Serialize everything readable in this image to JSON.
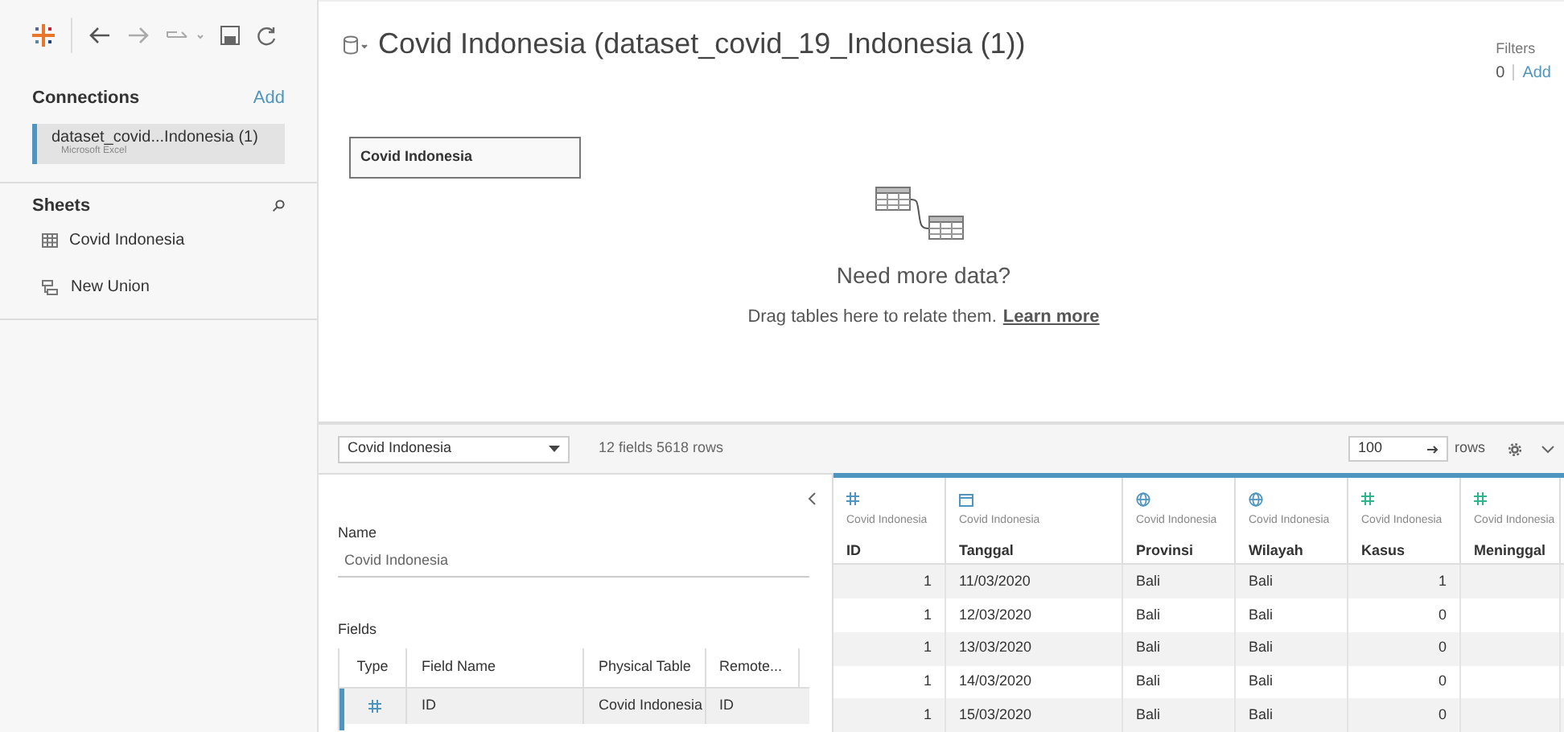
{
  "connections": {
    "title": "Connections",
    "add": "Add",
    "items": [
      {
        "name": "dataset_covid...Indonesia (1)",
        "type": "Microsoft Excel",
        "selected": true
      }
    ]
  },
  "sheets": {
    "title": "Sheets",
    "items": [
      {
        "kind": "table",
        "label": "Covid Indonesia"
      },
      {
        "kind": "union",
        "label": "New Union"
      }
    ]
  },
  "title": "Covid Indonesia (dataset_covid_19_Indonesia (1))",
  "filters": {
    "label": "Filters",
    "count": "0",
    "add": "Add"
  },
  "canvas": {
    "table": "Covid Indonesia",
    "heading": "Need more data?",
    "hint": "Drag tables here to relate them.",
    "link": "Learn more"
  },
  "grid_bar": {
    "table": "Covid Indonesia",
    "summary": "12 fields 5618 rows",
    "rows_value": "100",
    "rows_label": "rows"
  },
  "details": {
    "name_label": "Name",
    "name_value": "Covid Indonesia",
    "fields_label": "Fields",
    "columns": [
      "Type",
      "Field Name",
      "Physical Table",
      "Remote..."
    ],
    "rows": [
      {
        "kind": "number",
        "color": "#4e96c0",
        "name": "ID",
        "table": "Covid Indonesia",
        "remote": "ID",
        "selected": true
      }
    ]
  },
  "grid": {
    "columns": [
      {
        "kind": "number",
        "color": "#4e96c0",
        "source": "Covid Indonesia",
        "name": "ID"
      },
      {
        "kind": "date",
        "color": "#4e96c0",
        "source": "Covid Indonesia",
        "name": "Tanggal"
      },
      {
        "kind": "geo",
        "color": "#4e96c0",
        "source": "Covid Indonesia",
        "name": "Provinsi"
      },
      {
        "kind": "geo",
        "color": "#4e96c0",
        "source": "Covid Indonesia",
        "name": "Wilayah"
      },
      {
        "kind": "number",
        "color": "#2fb58c",
        "source": "Covid Indonesia",
        "name": "Kasus"
      },
      {
        "kind": "number",
        "color": "#2fb58c",
        "source": "Covid Indonesia",
        "name": "Meninggal"
      }
    ],
    "rows": [
      [
        "1",
        "11/03/2020",
        "Bali",
        "Bali",
        "1"
      ],
      [
        "1",
        "12/03/2020",
        "Bali",
        "Bali",
        "0"
      ],
      [
        "1",
        "13/03/2020",
        "Bali",
        "Bali",
        "0"
      ],
      [
        "1",
        "14/03/2020",
        "Bali",
        "Bali",
        "0"
      ],
      [
        "1",
        "15/03/2020",
        "Bali",
        "Bali",
        "0"
      ]
    ]
  }
}
